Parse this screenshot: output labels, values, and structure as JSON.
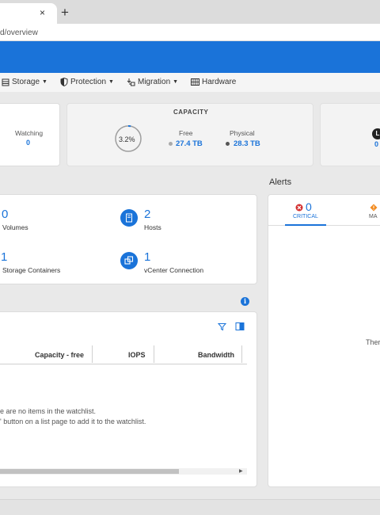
{
  "browser": {
    "close_glyph": "×",
    "new_tab_glyph": "+",
    "url": "d/overview"
  },
  "nav": {
    "storage": "Storage",
    "protection": "Protection",
    "migration": "Migration",
    "hardware": "Hardware"
  },
  "summary": {
    "watching_label": "Watching",
    "watching_value": "0",
    "capacity_title": "CAPACITY",
    "capacity_used_percent": "3.2%",
    "capacity_fraction": 0.032,
    "free_label": "Free",
    "free_value": "27.4 TB",
    "physical_label": "Physical",
    "physical_value": "28.3 TB",
    "right_badge": "L",
    "right_value": "0"
  },
  "inventory": {
    "volumes_value": "0",
    "volumes_label": "Volumes",
    "hosts_value": "2",
    "hosts_label": "Hosts",
    "containers_value": "1",
    "containers_label": "Storage Containers",
    "vcenter_value": "1",
    "vcenter_label": "vCenter Connection"
  },
  "watchlist": {
    "columns": [
      "Capacity - free",
      "IOPS",
      "Bandwidth"
    ],
    "empty_line1": "e are no items in the watchlist.",
    "empty_line2": "' button on a list page to add it to the watchlist."
  },
  "alerts": {
    "title": "Alerts",
    "critical_count": "0",
    "critical_label": "CRITICAL",
    "major_label": "MA",
    "empty_partial": "Ther"
  },
  "colors": {
    "accent": "#1a73d9",
    "critical": "#d32f2f",
    "major": "#f28b20"
  }
}
